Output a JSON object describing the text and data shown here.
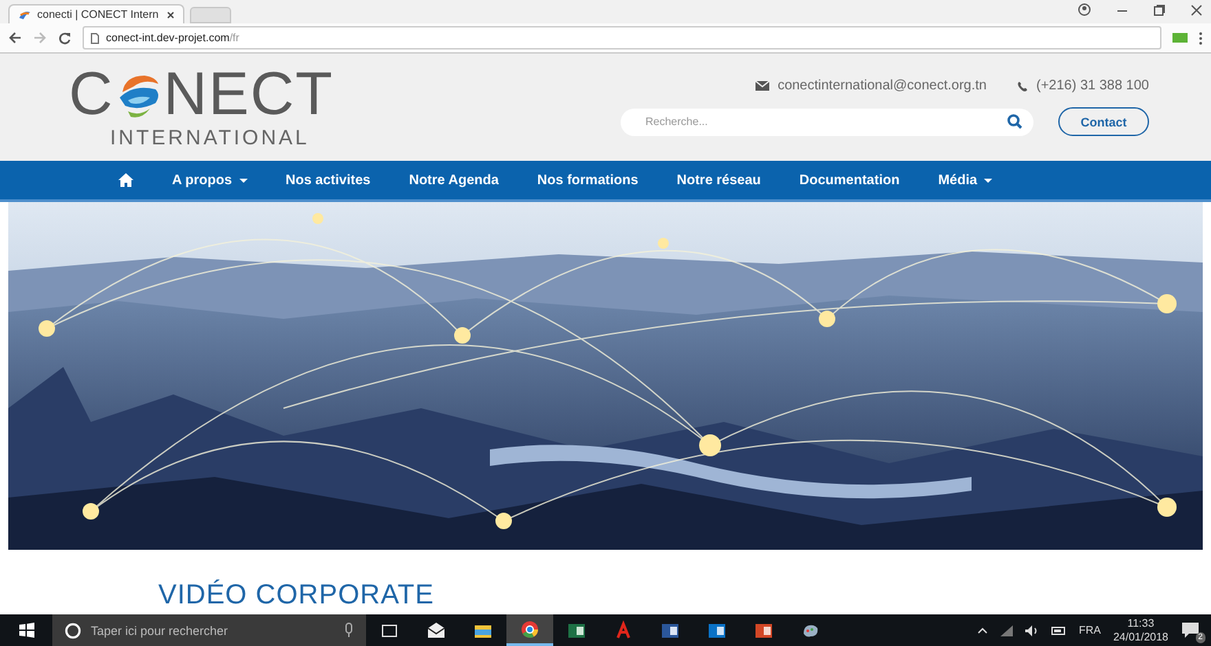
{
  "browser": {
    "tab_title": "conecti | CONECT Intern",
    "address": {
      "host": "conect-int.dev-projet.com",
      "path": "/fr"
    }
  },
  "header": {
    "logo": {
      "left": "C",
      "right": "NECT",
      "subtitle": "INTERNATIONAL"
    },
    "email": "conectinternational@conect.org.tn",
    "phone": "(+216) 31 388 100",
    "search": {
      "placeholder": "Recherche..."
    },
    "contact_button": "Contact"
  },
  "nav": {
    "items": [
      {
        "label": "A propos",
        "dropdown": true
      },
      {
        "label": "Nos activites",
        "dropdown": false
      },
      {
        "label": "Notre Agenda",
        "dropdown": false
      },
      {
        "label": "Nos formations",
        "dropdown": false
      },
      {
        "label": "Notre réseau",
        "dropdown": false
      },
      {
        "label": "Documentation",
        "dropdown": false
      },
      {
        "label": "Média",
        "dropdown": true
      }
    ]
  },
  "section_heading": "VIDÉO CORPORATE",
  "taskbar": {
    "search": {
      "placeholder": "Taper ici pour rechercher"
    },
    "apps": [
      {
        "kind": "taskview",
        "active": false
      },
      {
        "kind": "mail",
        "active": false
      },
      {
        "kind": "folder",
        "active": false
      },
      {
        "kind": "chrome",
        "active": true
      },
      {
        "kind": "excel",
        "active": false
      },
      {
        "kind": "pdf",
        "active": false
      },
      {
        "kind": "word",
        "active": false
      },
      {
        "kind": "outlook",
        "active": false
      },
      {
        "kind": "powerpoint",
        "active": false
      },
      {
        "kind": "paint",
        "active": false
      }
    ],
    "language": "FRA",
    "time": "11:33",
    "date": "24/01/2018",
    "notifications": "2"
  }
}
